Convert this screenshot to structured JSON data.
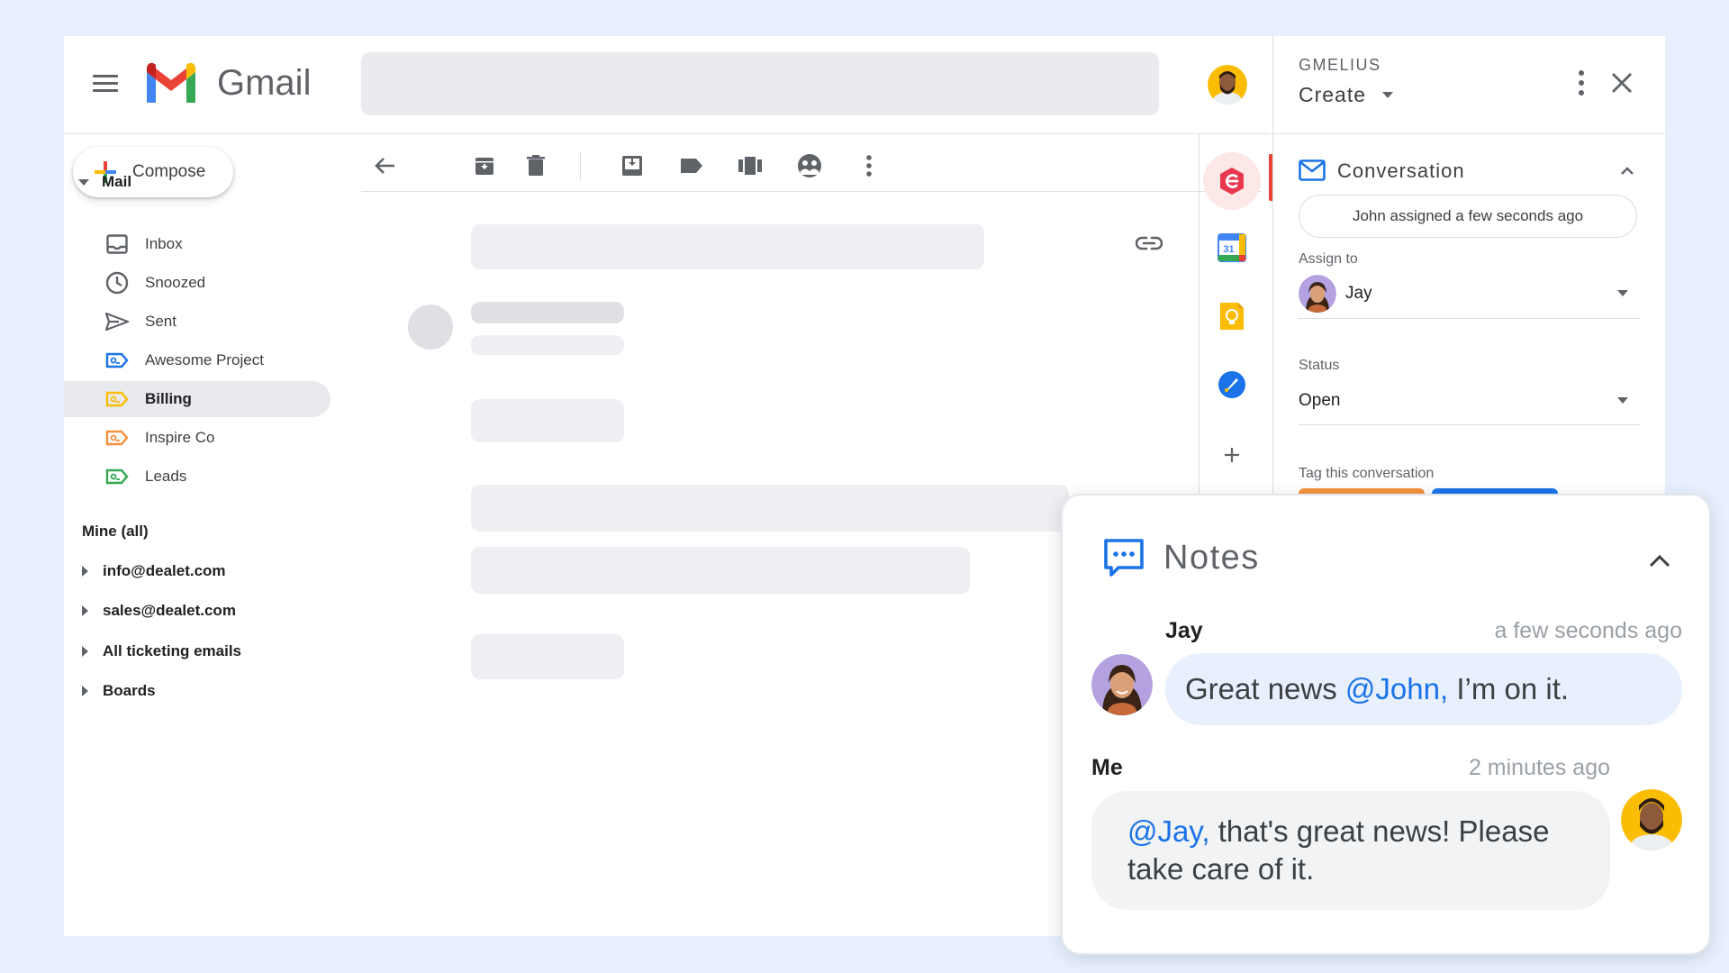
{
  "app": {
    "name": "Gmail"
  },
  "search": {
    "placeholder": ""
  },
  "compose": {
    "label": "Compose"
  },
  "nav": {
    "mail_section": "Mail",
    "items": [
      {
        "label": "Inbox",
        "icon": "inbox-icon"
      },
      {
        "label": "Snoozed",
        "icon": "clock-icon"
      },
      {
        "label": "Sent",
        "icon": "send-icon"
      },
      {
        "label": "Awesome Project",
        "icon": "label-icon",
        "color": "#1a73e8"
      },
      {
        "label": "Billing",
        "icon": "label-icon",
        "color": "#fbbc04",
        "active": true
      },
      {
        "label": "Inspire Co",
        "icon": "label-icon",
        "color": "#f3913c"
      },
      {
        "label": "Leads",
        "icon": "label-icon",
        "color": "#34a853"
      }
    ],
    "mine_section": "Mine (all)",
    "groups": [
      "info@dealet.com",
      "sales@dealet.com",
      "All ticketing emails",
      "Boards"
    ]
  },
  "toolbar": {
    "icons": [
      "back-arrow-icon",
      "archive-icon",
      "delete-icon",
      "move-to-inbox-icon",
      "label-icon",
      "kanban-icon",
      "shared-icon",
      "more-vert-icon"
    ]
  },
  "rail": {
    "icons": [
      "gmelius-icon",
      "calendar-icon",
      "keep-icon",
      "tasks-icon",
      "add-icon"
    ],
    "calendar_day": "31"
  },
  "gmelius": {
    "brand": "GMELIUS",
    "create_label": "Create",
    "conversation": {
      "title": "Conversation",
      "status_line": "John assigned a few seconds ago",
      "assign_label": "Assign to",
      "assignee": "Jay",
      "status_label": "Status",
      "status_value": "Open",
      "tag_label": "Tag this conversation"
    }
  },
  "notes": {
    "title": "Notes",
    "items": [
      {
        "author": "Jay",
        "time": "a few seconds ago",
        "text_before": "Great news ",
        "mention": "@John,",
        "text_after": " I’m on it."
      },
      {
        "author": "Me",
        "time": "2 minutes ago",
        "text_before": "",
        "mention": "@Jay,",
        "text_after": " that's great news! Please take care of it."
      }
    ]
  },
  "colors": {
    "background": "#e8f0fe",
    "accent_blue": "#1a73e8",
    "gmail_red": "#ea4335",
    "jay_bubble": "#e8f0fe",
    "me_bubble": "#f1f3f4"
  }
}
